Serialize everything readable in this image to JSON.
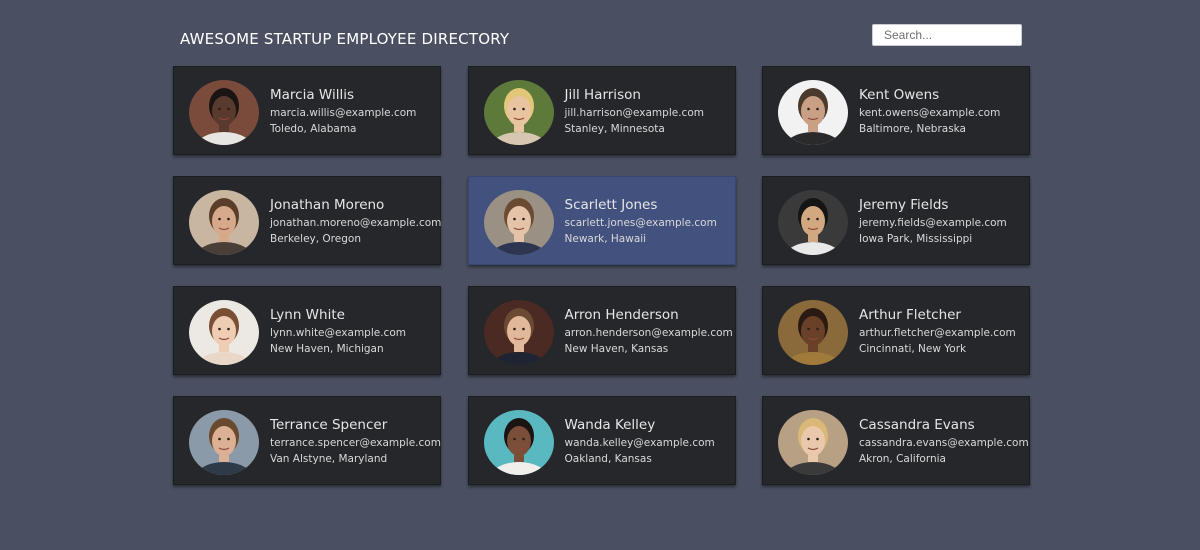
{
  "header": {
    "title": "AWESOME STARTUP EMPLOYEE DIRECTORY",
    "search_placeholder": "Search..."
  },
  "colors": {
    "background": "#4a5061",
    "card": "#26272b",
    "card_selected": "#43517f"
  },
  "employees": [
    {
      "name": "Marcia Willis",
      "email": "marcia.willis@example.com",
      "location": "Toledo, Alabama",
      "selected": false,
      "avatar": {
        "bg": "#7a4a3a",
        "skin": "#5a3a2c",
        "hair": "#1a1412",
        "shirt": "#e8e6e2"
      }
    },
    {
      "name": "Jill Harrison",
      "email": "jill.harrison@example.com",
      "location": "Stanley, Minnesota",
      "selected": false,
      "avatar": {
        "bg": "#5d7a3a",
        "skin": "#e8c4a0",
        "hair": "#e2c779",
        "shirt": "#d7c7b0"
      }
    },
    {
      "name": "Kent Owens",
      "email": "kent.owens@example.com",
      "location": "Baltimore, Nebraska",
      "selected": false,
      "avatar": {
        "bg": "#f2f2f2",
        "skin": "#c9a083",
        "hair": "#4a3a2e",
        "shirt": "#2a2a2a"
      }
    },
    {
      "name": "Jonathan Moreno",
      "email": "jonathan.moreno@example.com",
      "location": "Berkeley, Oregon",
      "selected": false,
      "avatar": {
        "bg": "#c9b6a0",
        "skin": "#d6a98a",
        "hair": "#5a3e2a",
        "shirt": "#4a3f38"
      }
    },
    {
      "name": "Scarlett Jones",
      "email": "scarlett.jones@example.com",
      "location": "Newark, Hawaii",
      "selected": true,
      "avatar": {
        "bg": "#9a9184",
        "skin": "#e5c3a8",
        "hair": "#6b4a32",
        "shirt": "#2e3550"
      }
    },
    {
      "name": "Jeremy Fields",
      "email": "jeremy.fields@example.com",
      "location": "Iowa Park, Mississippi",
      "selected": false,
      "avatar": {
        "bg": "#3a3a3a",
        "skin": "#d2a880",
        "hair": "#151515",
        "shirt": "#e9e9e9"
      }
    },
    {
      "name": "Lynn White",
      "email": "lynn.white@example.com",
      "location": "New Haven, Michigan",
      "selected": false,
      "avatar": {
        "bg": "#ece8e4",
        "skin": "#efcdb4",
        "hair": "#7a4e32",
        "shirt": "#ead7c7"
      }
    },
    {
      "name": "Arron Henderson",
      "email": "arron.henderson@example.com",
      "location": "New Haven, Kansas",
      "selected": false,
      "avatar": {
        "bg": "#4a2a22",
        "skin": "#e2b89a",
        "hair": "#6a4a32",
        "shirt": "#1f2433"
      }
    },
    {
      "name": "Arthur Fletcher",
      "email": "arthur.fletcher@example.com",
      "location": "Cincinnati, New York",
      "selected": false,
      "avatar": {
        "bg": "#8a6a3a",
        "skin": "#6a4028",
        "hair": "#2a1a12",
        "shirt": "#a07a3a"
      }
    },
    {
      "name": "Terrance Spencer",
      "email": "terrance.spencer@example.com",
      "location": "Van Alstyne, Maryland",
      "selected": false,
      "avatar": {
        "bg": "#8a9aa8",
        "skin": "#dcb094",
        "hair": "#6a4a2e",
        "shirt": "#2e3a48"
      }
    },
    {
      "name": "Wanda Kelley",
      "email": "wanda.kelley@example.com",
      "location": "Oakland, Kansas",
      "selected": false,
      "avatar": {
        "bg": "#5ab8c0",
        "skin": "#7a4e38",
        "hair": "#1a1412",
        "shirt": "#f0efec"
      }
    },
    {
      "name": "Cassandra Evans",
      "email": "cassandra.evans@example.com",
      "location": "Akron, California",
      "selected": false,
      "avatar": {
        "bg": "#b8a084",
        "skin": "#eac8ac",
        "hair": "#d9b878",
        "shirt": "#3a3a3a"
      }
    }
  ]
}
